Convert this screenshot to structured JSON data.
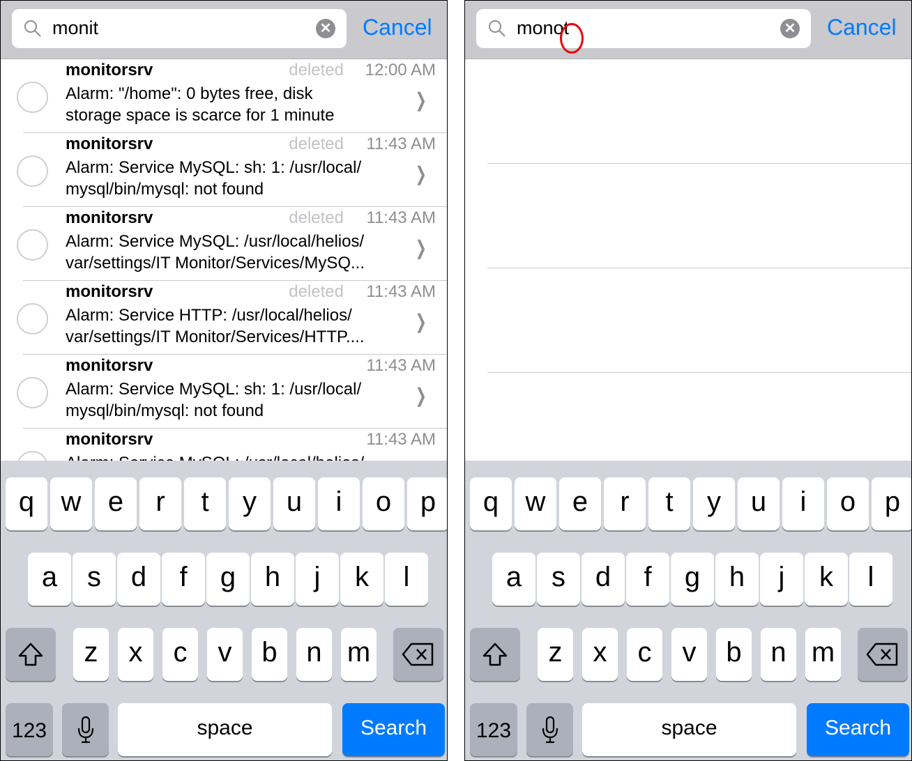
{
  "left": {
    "search": {
      "value": "monit",
      "cancel_label": "Cancel"
    },
    "rows": [
      {
        "name": "monitorsrv",
        "status": "deleted",
        "time": "12:00 AM",
        "message": "Alarm: \"/home\": 0 bytes free, disk\nstorage space is scarce for 1 minute"
      },
      {
        "name": "monitorsrv",
        "status": "deleted",
        "time": "11:43 AM",
        "message": "Alarm: Service MySQL: sh: 1: /usr/local/\nmysql/bin/mysql: not found"
      },
      {
        "name": "monitorsrv",
        "status": "deleted",
        "time": "11:43 AM",
        "message": "Alarm: Service MySQL: /usr/local/helios/\nvar/settings/IT Monitor/Services/MySQ..."
      },
      {
        "name": "monitorsrv",
        "status": "deleted",
        "time": "11:43 AM",
        "message": "Alarm: Service HTTP: /usr/local/helios/\nvar/settings/IT Monitor/Services/HTTP...."
      },
      {
        "name": "monitorsrv",
        "status": "",
        "time": "11:43 AM",
        "message": "Alarm: Service MySQL: sh: 1: /usr/local/\nmysql/bin/mysql: not found"
      },
      {
        "name": "monitorsrv",
        "status": "",
        "time": "11:43 AM",
        "message": "Alarm: Service MySQL: /usr/local/helios/"
      }
    ]
  },
  "right": {
    "search": {
      "value": "monot",
      "cancel_label": "Cancel"
    }
  },
  "keyboard": {
    "row1": [
      "q",
      "w",
      "e",
      "r",
      "t",
      "y",
      "u",
      "i",
      "o",
      "p"
    ],
    "row2": [
      "a",
      "s",
      "d",
      "f",
      "g",
      "h",
      "j",
      "k",
      "l"
    ],
    "row3": [
      "z",
      "x",
      "c",
      "v",
      "b",
      "n",
      "m"
    ],
    "numbers_label": "123",
    "space_label": "space",
    "search_label": "Search",
    "icons": {
      "shift": "shift-icon",
      "delete": "delete-icon",
      "mic": "microphone-icon"
    }
  },
  "colors": {
    "accent": "#007aff",
    "header_bg": "#c9c9ce",
    "keyboard_bg": "#d1d5db",
    "annotation": "#e00000"
  }
}
